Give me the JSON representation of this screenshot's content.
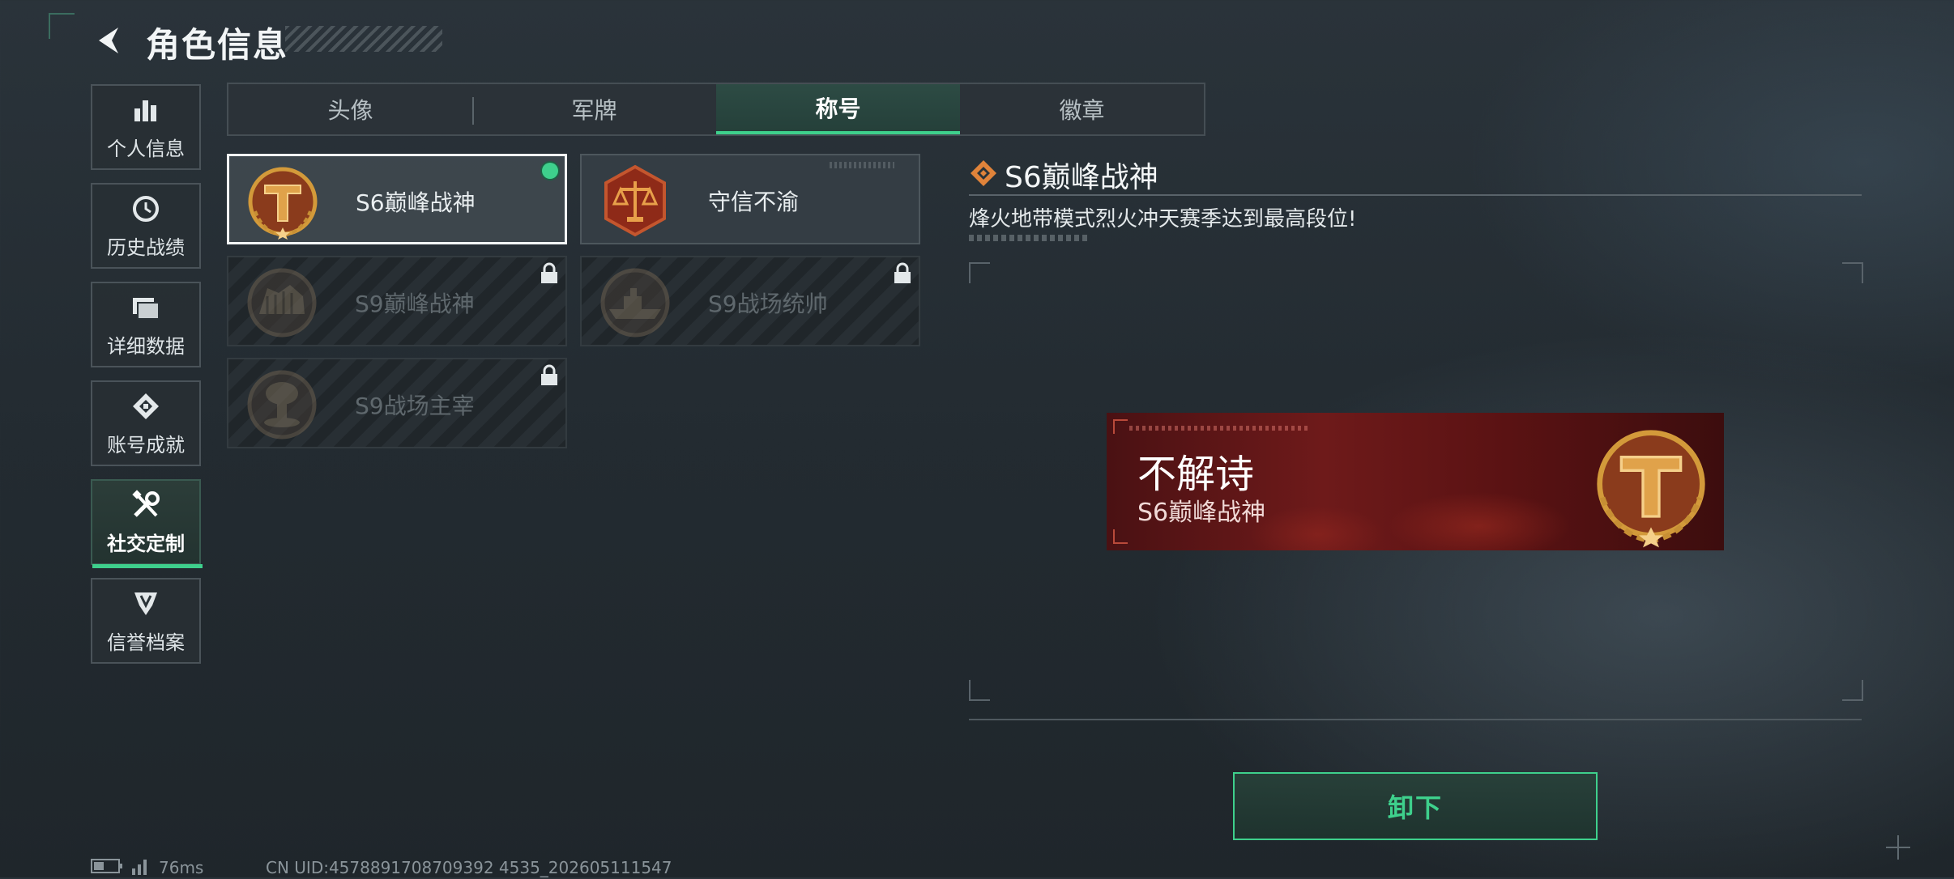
{
  "header": {
    "title": "角色信息"
  },
  "nav": {
    "items": [
      {
        "label": "个人信息",
        "icon": "bar-chart-icon"
      },
      {
        "label": "历史战绩",
        "icon": "history-clock-icon"
      },
      {
        "label": "详细数据",
        "icon": "folder-icon"
      },
      {
        "label": "账号成就",
        "icon": "achievement-icon"
      },
      {
        "label": "社交定制",
        "icon": "tools-icon",
        "active": true
      },
      {
        "label": "信誉档案",
        "icon": "shield-rank-icon"
      }
    ]
  },
  "tabs": [
    "头像",
    "军牌",
    "称号",
    "徽章"
  ],
  "active_tab": "称号",
  "titles": [
    {
      "name": "S6巅峰战神",
      "state": "equipped"
    },
    {
      "name": "守信不渝",
      "state": "owned"
    },
    {
      "name": "S9巅峰战神",
      "state": "locked"
    },
    {
      "name": "S9战场统帅",
      "state": "locked"
    },
    {
      "name": "S9战场主宰",
      "state": "locked"
    }
  ],
  "detail": {
    "title": "S6巅峰战神",
    "description": "烽火地带模式烈火冲天赛季达到最高段位!"
  },
  "nameplate": {
    "player_name": "不解诗",
    "title": "S6巅峰战神"
  },
  "action": {
    "unequip_label": "卸下"
  },
  "footer": {
    "ping": "76ms",
    "uid": "CN UID:4578891708709392 4535_202605111547"
  },
  "colors": {
    "accent": "#3ed08c",
    "gold": "#d39a3a",
    "plate_red": "#6e1a1a"
  }
}
